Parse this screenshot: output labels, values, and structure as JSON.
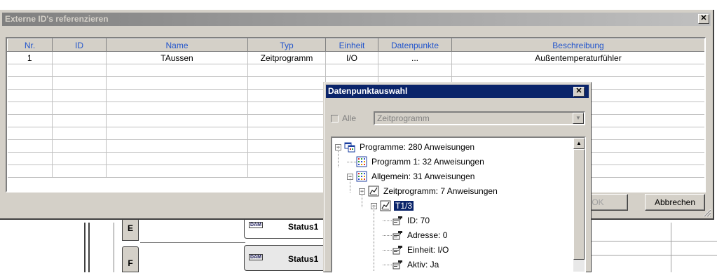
{
  "background": {
    "row_e_label": "E",
    "row_f_label": "F",
    "status_badge": "DAM",
    "status_1": "Status1",
    "status_2": "Status1"
  },
  "main_dialog": {
    "title": "Externe ID's referenzieren",
    "close_glyph": "✕",
    "columns": [
      "Nr.",
      "ID",
      "Name",
      "Typ",
      "Einheit",
      "Datenpunkte",
      "Beschreibung"
    ],
    "rows": [
      [
        "1",
        "",
        "TAussen",
        "Zeitprogramm",
        "I/O",
        "...",
        "Außentemperaturfühler"
      ],
      [
        "",
        "",
        "",
        "",
        "",
        "",
        ""
      ],
      [
        "",
        "",
        "",
        "",
        "",
        "",
        ""
      ],
      [
        "",
        "",
        "",
        "",
        "",
        "",
        ""
      ],
      [
        "",
        "",
        "",
        "",
        "",
        "",
        ""
      ],
      [
        "",
        "",
        "",
        "",
        "",
        "",
        ""
      ],
      [
        "",
        "",
        "",
        "",
        "",
        "",
        ""
      ],
      [
        "",
        "",
        "",
        "",
        "",
        "",
        ""
      ],
      [
        "",
        "",
        "",
        "",
        "",
        "",
        ""
      ],
      [
        "",
        "",
        "",
        "",
        "",
        "",
        ""
      ]
    ],
    "ok_label": "OK",
    "cancel_label": "Abbrechen"
  },
  "dp_dialog": {
    "title": "Datenpunktauswahl",
    "close_glyph": "✕",
    "alle_label": "Alle",
    "combo_value": "Zeitprogramm",
    "tree": [
      {
        "label": "Programme: 280 Anweisungen",
        "icon": "programs-icon",
        "expander": "−"
      },
      {
        "label": "Programm 1: 32 Anweisungen",
        "icon": "program-grid-icon",
        "expander": ""
      },
      {
        "label": "Allgemein: 31 Anweisungen",
        "icon": "program-grid-icon",
        "expander": "−"
      },
      {
        "label": "Zeitprogramm: 7 Anweisungen",
        "icon": "timer-icon",
        "expander": "−"
      },
      {
        "label": "T1/3",
        "icon": "timer-icon",
        "expander": "−",
        "selected": true
      },
      {
        "label": "ID: 70",
        "icon": "property-icon",
        "expander": ""
      },
      {
        "label": "Adresse: 0",
        "icon": "property-icon",
        "expander": ""
      },
      {
        "label": "Einheit: I/O",
        "icon": "property-icon",
        "expander": ""
      },
      {
        "label": "Aktiv: Ja",
        "icon": "property-icon",
        "expander": ""
      }
    ]
  }
}
